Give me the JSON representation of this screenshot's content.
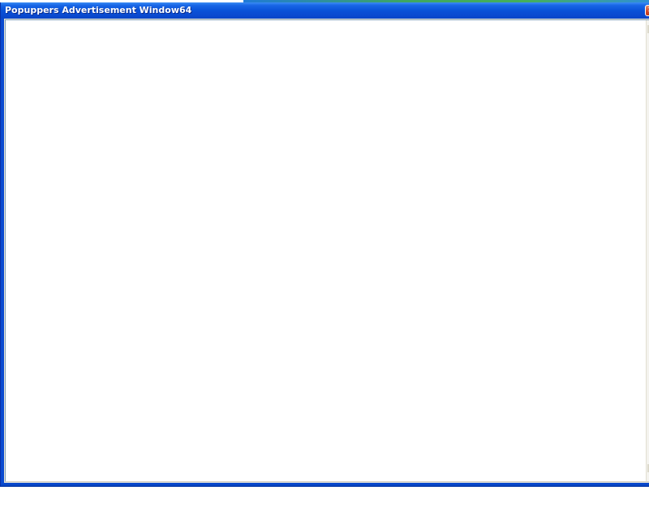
{
  "window": {
    "title": "Popuppers Advertisement Window64",
    "close_glyph": "✕"
  },
  "icons": {
    "close": "close-icon"
  },
  "colors": {
    "titlebar": "#0a4ad0",
    "content_bg": "#ffffff",
    "close_button": "#d44a28"
  }
}
